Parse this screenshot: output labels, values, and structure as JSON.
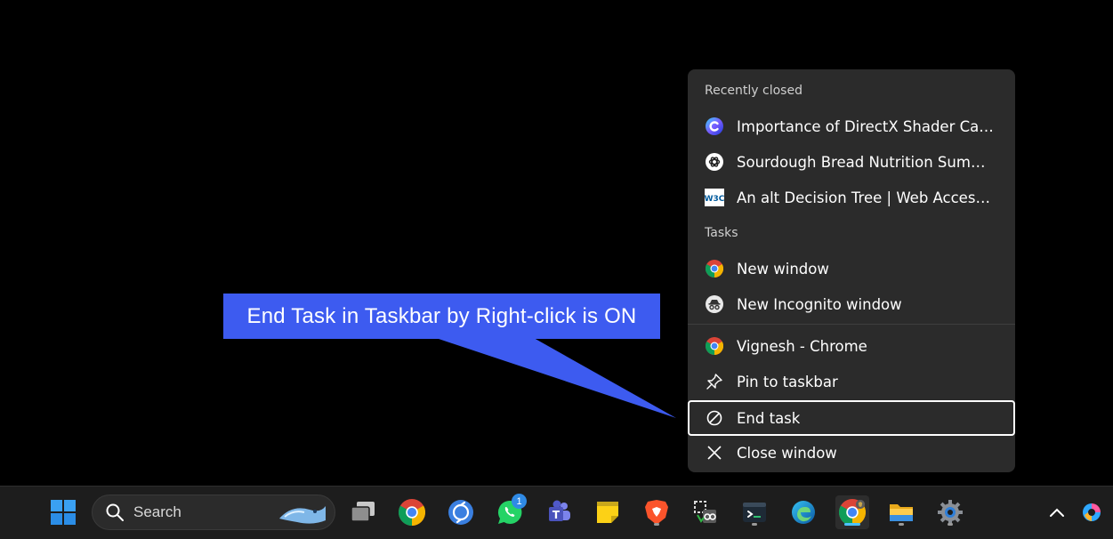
{
  "callout": {
    "text": "End Task in Taskbar by Right-click is ON"
  },
  "jump_list": {
    "recently_closed_header": "Recently closed",
    "recent_items": [
      {
        "label": "Importance of DirectX Shader Cac...",
        "icon": "copilot-icon"
      },
      {
        "label": "Sourdough Bread Nutrition Summ...",
        "icon": "chatgpt-icon"
      },
      {
        "label": "An alt Decision Tree | Web Accessi...",
        "icon": "w3c-icon"
      }
    ],
    "tasks_header": "Tasks",
    "task_items": [
      {
        "label": "New window",
        "icon": "chrome-icon"
      },
      {
        "label": "New Incognito window",
        "icon": "incognito-icon"
      }
    ],
    "app_items": [
      {
        "label": "Vignesh - Chrome",
        "icon": "chrome-profile-icon"
      },
      {
        "label": "Pin to taskbar",
        "icon": "pin-icon"
      },
      {
        "label": "End task",
        "icon": "end-task-icon"
      },
      {
        "label": "Close window",
        "icon": "close-icon"
      }
    ]
  },
  "taskbar": {
    "search_label": "Search",
    "whatsapp_badge": "1",
    "apps": [
      "start-icon",
      "task-view-icon",
      "chrome-icon",
      "sync-icon",
      "whatsapp-icon",
      "teams-icon",
      "sticky-notes-icon",
      "brave-icon",
      "snipping-tool-icon",
      "terminal-icon",
      "edge-icon",
      "chrome-active-icon",
      "file-explorer-icon",
      "settings-icon"
    ],
    "tray": [
      "chevron-up-icon",
      "copilot-tray-icon"
    ]
  },
  "colors": {
    "callout": "#3d5bf0",
    "menu_bg": "#2b2b2b",
    "taskbar_bg": "#1d1d1d",
    "accent": "#4cc2ff"
  }
}
